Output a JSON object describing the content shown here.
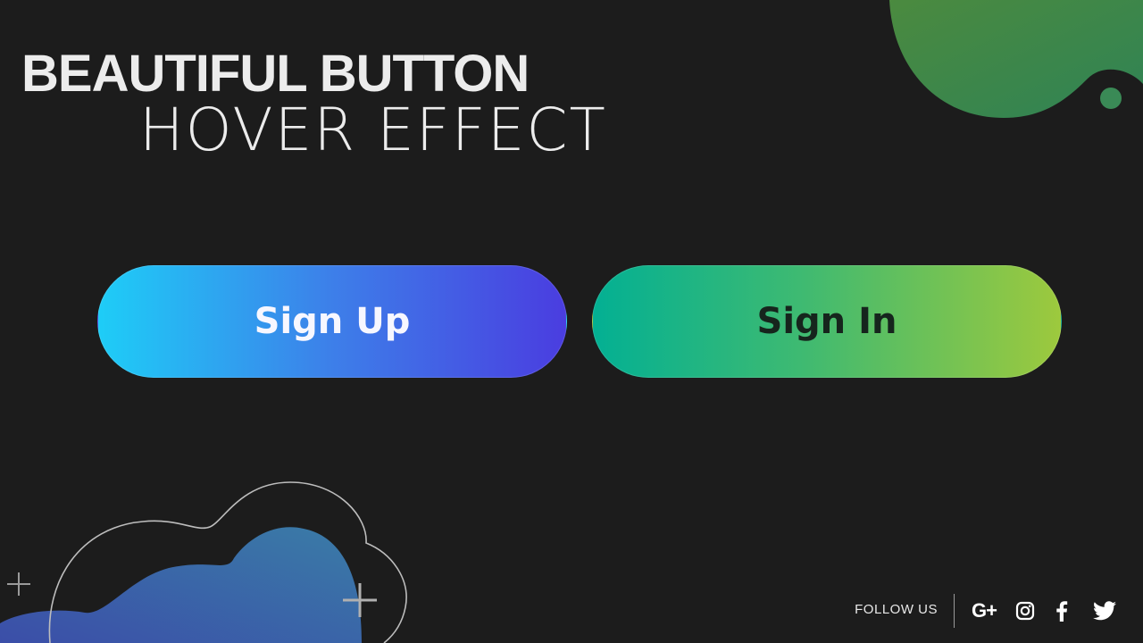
{
  "header": {
    "title_line1": "BEAUTIFUL BUTTON",
    "title_line2": "HOVER EFFECT"
  },
  "buttons": {
    "signup_label": "Sign Up",
    "signin_label": "Sign In"
  },
  "footer": {
    "follow_label": "FOLLOW US",
    "social": [
      {
        "icon": "google-plus-icon",
        "label": "G+"
      },
      {
        "icon": "instagram-icon"
      },
      {
        "icon": "facebook-icon"
      },
      {
        "icon": "twitter-icon"
      }
    ]
  },
  "colors": {
    "background": "#1c1c1c",
    "signup_gradient": [
      "#1ecdf7",
      "#4a3de0"
    ],
    "signin_gradient": [
      "#03b093",
      "#9dc93d"
    ],
    "top_blob": "#3f8a4e",
    "bottom_blob": [
      "#3a4fa6",
      "#3b78a6"
    ]
  }
}
